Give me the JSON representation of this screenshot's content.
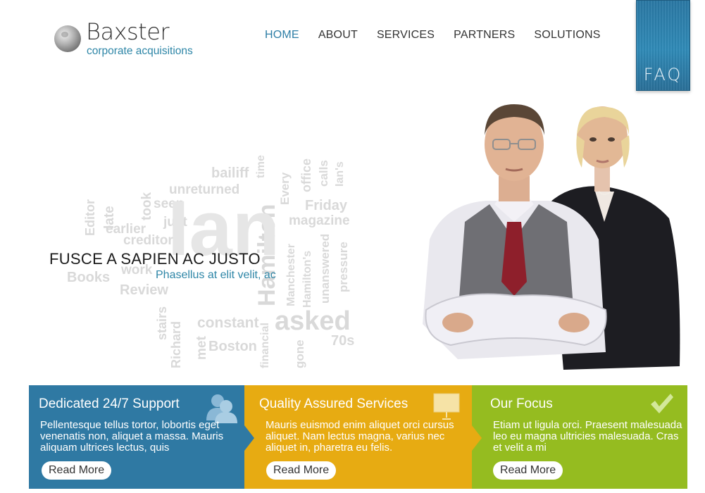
{
  "header": {
    "brand_name": "Baxster",
    "brand_tagline": "corporate acquisitions",
    "nav": [
      {
        "label": "HOME",
        "active": true
      },
      {
        "label": "ABOUT",
        "active": false
      },
      {
        "label": "SERVICES",
        "active": false
      },
      {
        "label": "PARTNERS",
        "active": false
      },
      {
        "label": "SOLUTIONS",
        "active": false
      }
    ],
    "faq_label": "FAQ"
  },
  "hero": {
    "headline": "FUSCE A SAPIEN AC JUSTO",
    "subheadline": "Phasellus at elit velit, ac",
    "word_cloud": [
      "bailiff",
      "time",
      "unreturned",
      "office",
      "calls",
      "Ian's",
      "Every",
      "took",
      "seen",
      "Friday",
      "Editor",
      "late",
      "just",
      "magazine",
      "earlier",
      "creditor",
      "Manchester",
      "Hamilton's",
      "unanswered",
      "pressure",
      "Books",
      "work",
      "Review",
      "Hamilton",
      "stairs",
      "Richard",
      "met",
      "constant",
      "financial",
      "gone",
      "asked",
      "Boston",
      "70s",
      "Ian"
    ]
  },
  "features": [
    {
      "title": "Dedicated 24/7 Support",
      "text": "Pellentesque tellus tortor, lobortis eget venenatis non, aliquet a massa. Mauris aliquam ultrices lectus, quis",
      "button": "Read More",
      "icon": "users-icon",
      "color": "#2f79a3"
    },
    {
      "title": "Quality Assured Services",
      "text": "Mauris euismod enim aliquet orci cursus aliquet. Nam lectus magna, varius nec aliquet in, pharetra eu felis.",
      "button": "Read More",
      "icon": "presentation-board-icon",
      "color": "#e7ab12"
    },
    {
      "title": "Our Focus",
      "text": "Etiam ut ligula orci. Praesent malesuada leo eu magna ultricies malesuada. Cras et velit a mi",
      "button": "Read More",
      "icon": "checkmark-icon",
      "color": "#95bc20"
    }
  ],
  "colors": {
    "accent": "#2e86a7",
    "blue": "#2f79a3",
    "yellow": "#e7ab12",
    "green": "#95bc20"
  }
}
